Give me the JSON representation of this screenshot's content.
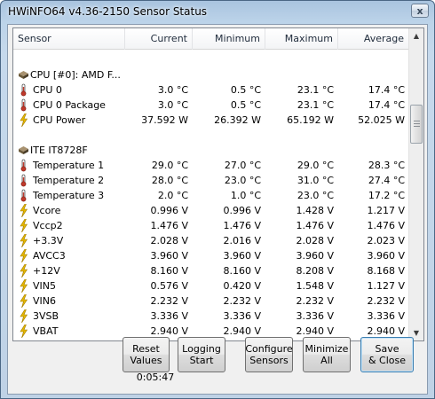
{
  "window": {
    "title": "HWiNFO64 v4.36-2150 Sensor Status",
    "close_glyph": "x"
  },
  "columns": {
    "sensor": "Sensor",
    "current": "Current",
    "minimum": "Minimum",
    "maximum": "Maximum",
    "average": "Average"
  },
  "rows": [
    {
      "type": "blank"
    },
    {
      "type": "group",
      "icon": "chip-icon",
      "sensor": "CPU [#0]: AMD F...",
      "current": "",
      "minimum": "",
      "maximum": "",
      "average": ""
    },
    {
      "type": "temp",
      "icon": "thermometer-icon",
      "sensor": "CPU 0",
      "current": "3.0 °C",
      "minimum": "0.5 °C",
      "maximum": "23.1 °C",
      "average": "17.4 °C"
    },
    {
      "type": "temp",
      "icon": "thermometer-icon",
      "sensor": "CPU 0 Package",
      "current": "3.0 °C",
      "minimum": "0.5 °C",
      "maximum": "23.1 °C",
      "average": "17.4 °C"
    },
    {
      "type": "power",
      "icon": "lightning-icon",
      "sensor": "CPU Power",
      "current": "37.592 W",
      "minimum": "26.392 W",
      "maximum": "65.192 W",
      "average": "52.025 W"
    },
    {
      "type": "blank"
    },
    {
      "type": "group",
      "icon": "chip-icon",
      "sensor": "ITE IT8728F",
      "current": "",
      "minimum": "",
      "maximum": "",
      "average": ""
    },
    {
      "type": "temp",
      "icon": "thermometer-icon",
      "sensor": "Temperature 1",
      "current": "29.0 °C",
      "minimum": "27.0 °C",
      "maximum": "29.0 °C",
      "average": "28.3 °C"
    },
    {
      "type": "temp",
      "icon": "thermometer-icon",
      "sensor": "Temperature 2",
      "current": "28.0 °C",
      "minimum": "23.0 °C",
      "maximum": "31.0 °C",
      "average": "27.4 °C"
    },
    {
      "type": "temp",
      "icon": "thermometer-icon",
      "sensor": "Temperature 3",
      "current": "2.0 °C",
      "minimum": "1.0 °C",
      "maximum": "23.0 °C",
      "average": "17.2 °C"
    },
    {
      "type": "volt",
      "icon": "lightning-icon",
      "sensor": "Vcore",
      "current": "0.996 V",
      "minimum": "0.996 V",
      "maximum": "1.428 V",
      "average": "1.217 V"
    },
    {
      "type": "volt",
      "icon": "lightning-icon",
      "sensor": "Vccp2",
      "current": "1.476 V",
      "minimum": "1.476 V",
      "maximum": "1.476 V",
      "average": "1.476 V"
    },
    {
      "type": "volt",
      "icon": "lightning-icon",
      "sensor": "+3.3V",
      "current": "2.028 V",
      "minimum": "2.016 V",
      "maximum": "2.028 V",
      "average": "2.023 V"
    },
    {
      "type": "volt",
      "icon": "lightning-icon",
      "sensor": "AVCC3",
      "current": "3.960 V",
      "minimum": "3.960 V",
      "maximum": "3.960 V",
      "average": "3.960 V"
    },
    {
      "type": "volt",
      "icon": "lightning-icon",
      "sensor": "+12V",
      "current": "8.160 V",
      "minimum": "8.160 V",
      "maximum": "8.208 V",
      "average": "8.168 V"
    },
    {
      "type": "volt",
      "icon": "lightning-icon",
      "sensor": "VIN5",
      "current": "0.576 V",
      "minimum": "0.420 V",
      "maximum": "1.548 V",
      "average": "1.127 V"
    },
    {
      "type": "volt",
      "icon": "lightning-icon",
      "sensor": "VIN6",
      "current": "2.232 V",
      "minimum": "2.232 V",
      "maximum": "2.232 V",
      "average": "2.232 V"
    },
    {
      "type": "volt",
      "icon": "lightning-icon",
      "sensor": "3VSB",
      "current": "3.336 V",
      "minimum": "3.336 V",
      "maximum": "3.336 V",
      "average": "3.336 V"
    },
    {
      "type": "volt",
      "icon": "lightning-icon",
      "sensor": "VBAT",
      "current": "2.940 V",
      "minimum": "2.940 V",
      "maximum": "2.940 V",
      "average": "2.940 V"
    }
  ],
  "buttons": {
    "reset": [
      "Reset",
      "Values"
    ],
    "logging": [
      "Logging",
      "Start"
    ],
    "configure": [
      "Configure",
      "Sensors"
    ],
    "minimize": [
      "Minimize",
      "All"
    ],
    "save": [
      "Save",
      "& Close"
    ]
  },
  "timer": "0:05:47",
  "colors": {
    "thermometer": "#c0392b",
    "lightning": "#e6b800",
    "chip": "#6b5a3a"
  }
}
